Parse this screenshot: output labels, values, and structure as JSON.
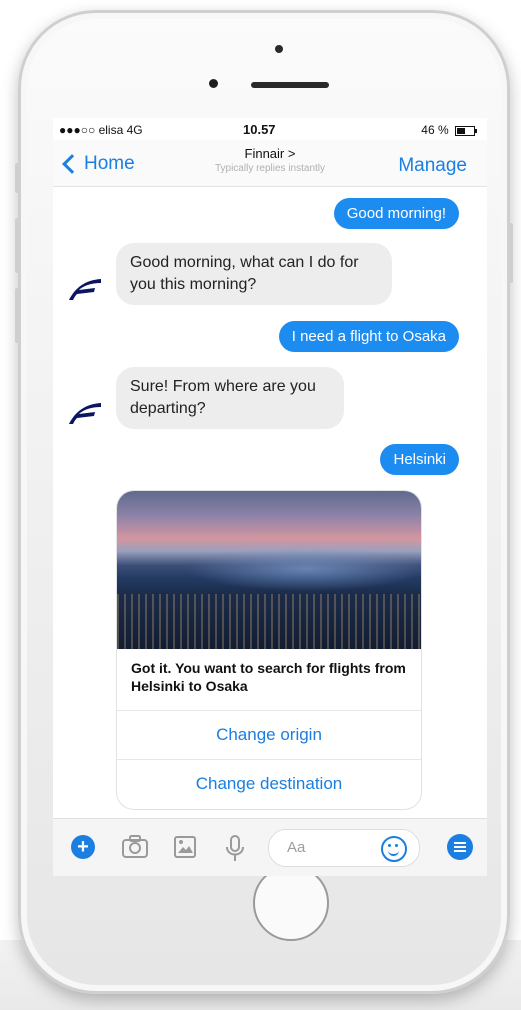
{
  "status_bar": {
    "carrier": "●●●○○ elisa  4G",
    "time": "10.57",
    "battery": "46 %"
  },
  "nav": {
    "back_label": "Home",
    "title": "Finnair >",
    "subtitle": "Typically replies instantly",
    "manage_label": "Manage"
  },
  "messages": [
    {
      "from": "user",
      "text": "Good morning!"
    },
    {
      "from": "bot",
      "text": "Good morning, what can I do for you this morning?"
    },
    {
      "from": "user",
      "text": "I need a flight to Osaka"
    },
    {
      "from": "bot",
      "text": "Sure! From where are you departing?"
    },
    {
      "from": "user",
      "text": "Helsinki"
    }
  ],
  "card": {
    "caption": "Got it. You want to search for flights from Helsinki to Osaka",
    "buttons": [
      "Change origin",
      "Change destination"
    ]
  },
  "composer": {
    "placeholder": "Aa"
  },
  "colors": {
    "accent": "#1d8cf0",
    "bot_bubble": "#ededed",
    "brand": "#0b1560"
  },
  "icons": [
    "back-chevron-icon",
    "plus-icon",
    "camera-icon",
    "gallery-icon",
    "microphone-icon",
    "emoji-icon",
    "menu-icon",
    "finnair-logo-icon"
  ]
}
